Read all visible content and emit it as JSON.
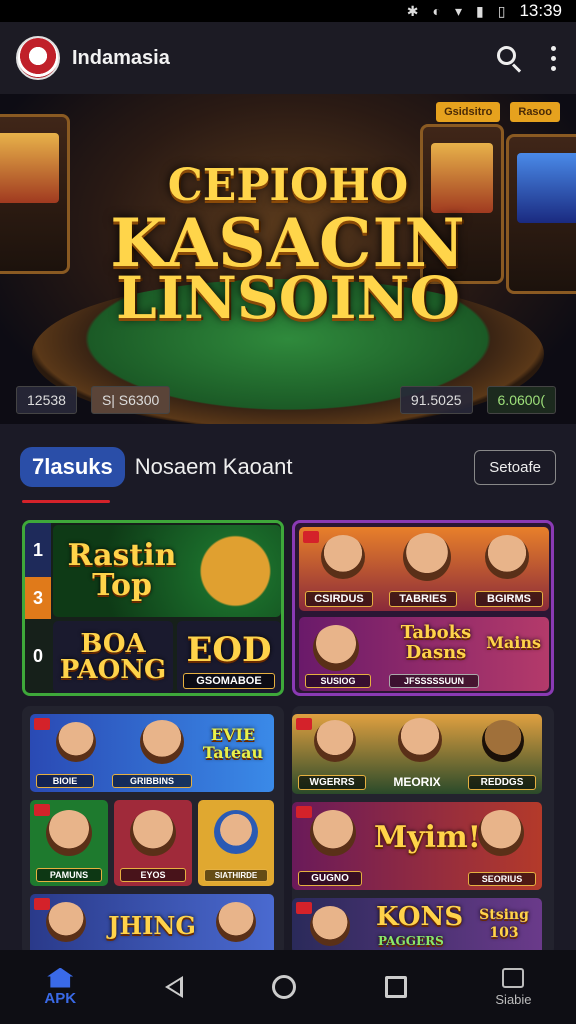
{
  "status_bar": {
    "time": "13:39",
    "icons": [
      "bluetooth-icon",
      "mute-icon",
      "wifi-icon",
      "signal-icon",
      "battery-icon"
    ]
  },
  "app_bar": {
    "title": "Indamasia"
  },
  "hero": {
    "badges": [
      "Gsidsitro",
      "Rasoo"
    ],
    "title_line1": "CEPIOHO",
    "title_line2": "KASACIN",
    "title_line3": "LINSOINO",
    "stats": [
      "12538",
      "S| S6300",
      "91.5025",
      "6.0600("
    ]
  },
  "section": {
    "active_tab": "7lasuks",
    "tab2": "Nosaem Kaoant",
    "see_button": "Setoafe"
  },
  "featured_left": {
    "numbers": [
      "1",
      "3",
      "0"
    ],
    "tile1": "Rastin Top",
    "tile2": "BOA PAONG",
    "tile3": "EOD",
    "tile3_caption": "GSOMABOE"
  },
  "featured_right": {
    "captions": [
      "CSIRDUS",
      "TABRIES",
      "BGIRMS"
    ],
    "tile_title": "Taboks Dasns",
    "tile_caption": "SUSIOG",
    "tile_sub": "JFSSSSSUUN",
    "tile_side": "Mains"
  },
  "grid_left": {
    "banner_title": "EVIE Tateau",
    "banner_caption": "BIOIE",
    "banner_caption2": "GRIBBINS",
    "row2": [
      "PAMUNS",
      "EYOS",
      "SIATHIRDE"
    ],
    "bottom_title": "JHING"
  },
  "grid_right": {
    "row1": [
      "WGERRS",
      "MEORIX",
      "REDDGS"
    ],
    "row2_title": "Myim!",
    "row2": [
      "GUGNO",
      "SEORIUS"
    ],
    "bottom": [
      "KONS",
      "PAGGERS",
      "Stsing 103"
    ]
  },
  "nav_bar": {
    "home_label": "APK",
    "right_label": "Siabie"
  }
}
